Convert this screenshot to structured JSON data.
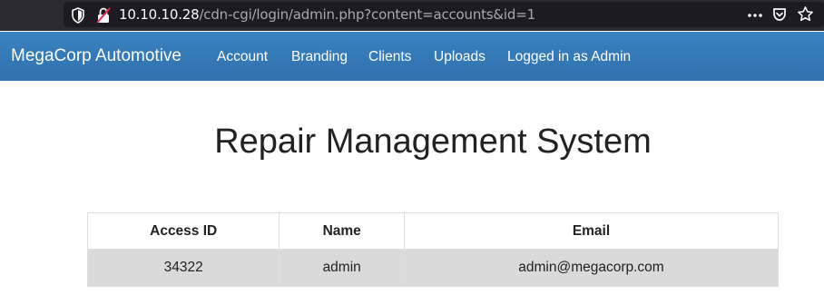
{
  "browser": {
    "url_host": "10.10.10.28",
    "url_path": "/cdn-cgi/login/admin.php?content=accounts&id=1"
  },
  "navbar": {
    "brand": "MegaCorp Automotive",
    "items": [
      {
        "label": "Account"
      },
      {
        "label": "Branding"
      },
      {
        "label": "Clients"
      },
      {
        "label": "Uploads"
      },
      {
        "label": "Logged in as Admin"
      }
    ]
  },
  "main": {
    "title": "Repair Management System"
  },
  "table": {
    "headers": [
      "Access ID",
      "Name",
      "Email"
    ],
    "rows": [
      [
        "34322",
        "admin",
        "admin@megacorp.com"
      ]
    ]
  },
  "colors": {
    "navbar": "#337ab7",
    "browser_chrome": "#2b2a33",
    "row_background": "#dadada"
  }
}
